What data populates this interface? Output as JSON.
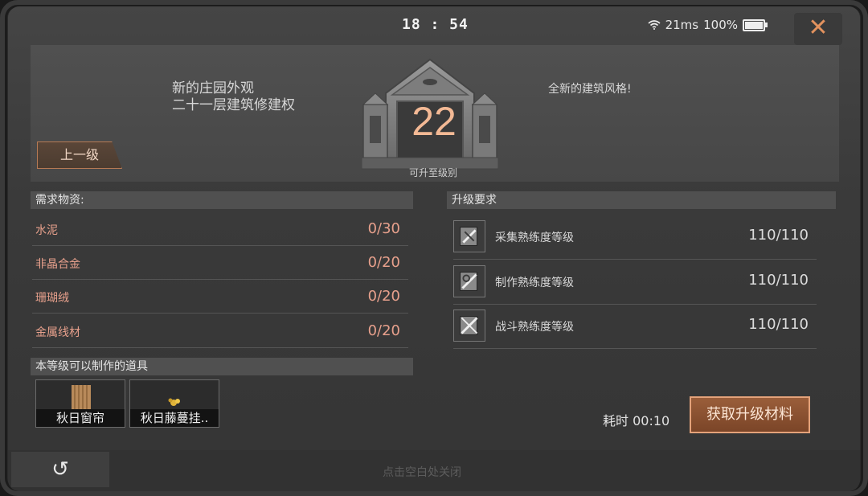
{
  "status_bar": {
    "time": "18 : 54",
    "ping": "21ms",
    "battery": "100%"
  },
  "close_glyph": "✕",
  "banner": {
    "feature_left_line1": "新的庄园外观",
    "feature_left_line2": "二十一层建筑修建权",
    "feature_right": "全新的建筑风格!",
    "prev_level_button": "上一级",
    "level_number": "22",
    "upgrade_to_label": "可升至级别"
  },
  "materials": {
    "header": "需求物资:",
    "items": [
      {
        "name": "水泥",
        "count": "0/30"
      },
      {
        "name": "非晶合金",
        "count": "0/20"
      },
      {
        "name": "珊瑚绒",
        "count": "0/20"
      },
      {
        "name": "金属线材",
        "count": "0/20"
      }
    ]
  },
  "requirements": {
    "header": "升级要求",
    "items": [
      {
        "name": "采集熟练度等级",
        "value": "110/110",
        "icon": "gathering-skill-icon"
      },
      {
        "name": "制作熟练度等级",
        "value": "110/110",
        "icon": "crafting-skill-icon"
      },
      {
        "name": "战斗熟练度等级",
        "value": "110/110",
        "icon": "combat-skill-icon"
      }
    ]
  },
  "craftable": {
    "header": "本等级可以制作的道具",
    "items": [
      {
        "label": "秋日窗帘"
      },
      {
        "label": "秋日藤蔓挂.."
      }
    ]
  },
  "duration_label": "耗时 00:10",
  "get_materials_button": "获取升级材料",
  "back_glyph": "↺",
  "close_hint": "点击空白处关闭",
  "colors": {
    "accent": "#e2925e",
    "material_text": "#e7a08c",
    "level_number": "#f3b995"
  }
}
